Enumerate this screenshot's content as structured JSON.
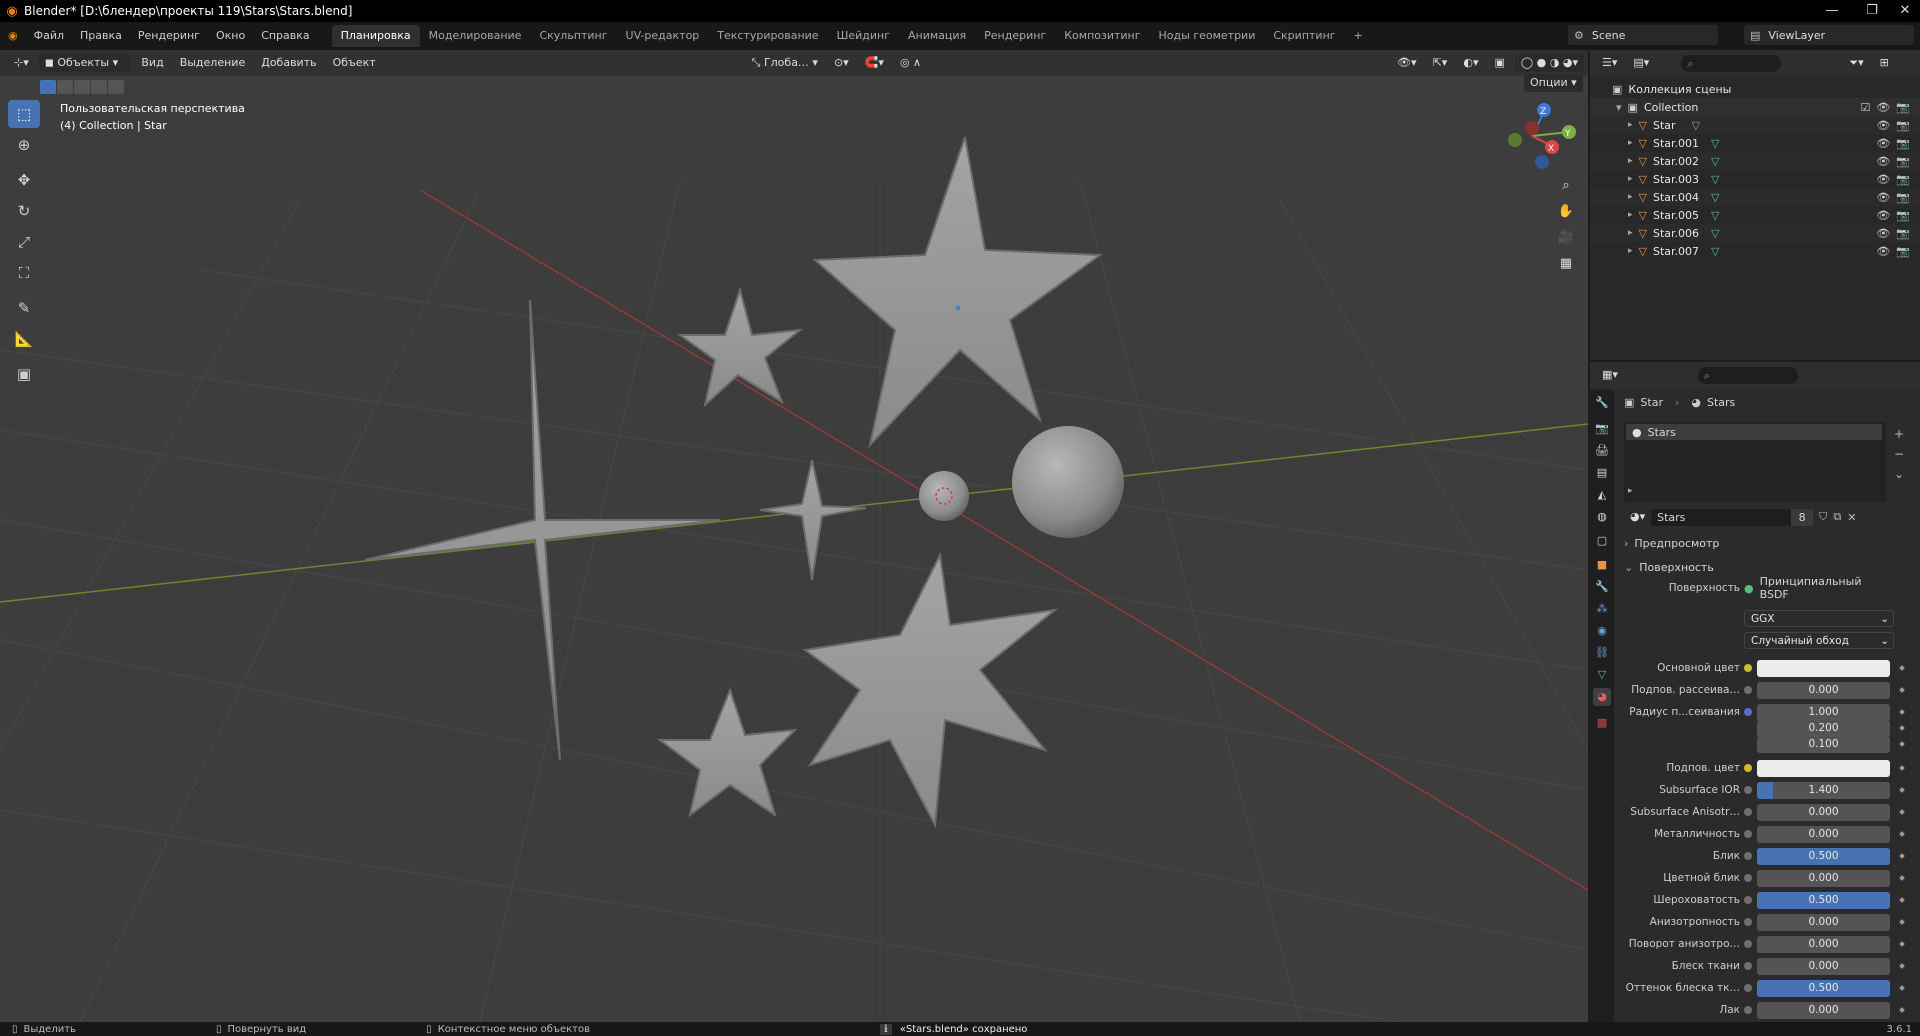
{
  "window": {
    "title": "Blender* [D:\\блендер\\проекты 119\\Stars\\Stars.blend]"
  },
  "menu": [
    "Файл",
    "Правка",
    "Рендеринг",
    "Окно",
    "Справка"
  ],
  "workspaces": {
    "active": "Планировка",
    "tabs": [
      "Моделирование",
      "Скульптинг",
      "UV-редактор",
      "Текстурирование",
      "Шейдинг",
      "Анимация",
      "Рендеринг",
      "Композитинг",
      "Ноды геометрии",
      "Скриптинг"
    ],
    "add": "+"
  },
  "scene": {
    "name": "Scene",
    "view_layer": "ViewLayer"
  },
  "viewport": {
    "mode": "Объекты",
    "menus": [
      "Вид",
      "Выделение",
      "Добавить",
      "Объект"
    ],
    "orientation": "Глоба…",
    "options": "Опции",
    "info_line1": "Пользовательская перспектива",
    "info_line2": "(4) Collection | Star",
    "gizmo": {
      "x": "X",
      "y": "Y",
      "z": "Z"
    }
  },
  "outliner": {
    "root": "Коллекция сцены",
    "collection": "Collection",
    "objects": [
      "Star",
      "Star.001",
      "Star.002",
      "Star.003",
      "Star.004",
      "Star.005",
      "Star.006",
      "Star.007"
    ]
  },
  "properties": {
    "breadcrumb_object": "Star",
    "breadcrumb_material": "Stars",
    "slot_name": "Stars",
    "material_name": "Stars",
    "users": "8",
    "panel_preview": "Предпросмотр",
    "panel_surface": "Поверхность",
    "surface_label": "Поверхность",
    "surface_shader": "Принципиальный BSDF",
    "distribution": "GGX",
    "subsurface_method": "Случайный обход",
    "fields": [
      {
        "label": "Основной цвет",
        "value": "",
        "color": "#ececec",
        "dot": "yellow",
        "fill": 0
      },
      {
        "label": "Подпов. рассеива…",
        "value": "0.000",
        "dot": "grey",
        "fill": 0
      },
      {
        "label": "Радиус п...сеивания",
        "value": "1.000",
        "dot": "blue",
        "fill": 0
      },
      {
        "label": "",
        "value": "0.200",
        "dot": "",
        "fill": 0
      },
      {
        "label": "",
        "value": "0.100",
        "dot": "",
        "fill": 0
      },
      {
        "label": "Подпов. цвет",
        "value": "",
        "color": "#ececec",
        "dot": "yellow",
        "fill": 0
      },
      {
        "label": "Subsurface IOR",
        "value": "1.400",
        "dot": "grey",
        "fill": 0.12
      },
      {
        "label": "Subsurface Anisotr…",
        "value": "0.000",
        "dot": "grey",
        "fill": 0
      },
      {
        "label": "Металличность",
        "value": "0.000",
        "dot": "grey",
        "fill": 0
      },
      {
        "label": "Блик",
        "value": "0.500",
        "dot": "grey",
        "fill": 1.0
      },
      {
        "label": "Цветной блик",
        "value": "0.000",
        "dot": "grey",
        "fill": 0
      },
      {
        "label": "Шероховатость",
        "value": "0.500",
        "dot": "grey",
        "fill": 1.0
      },
      {
        "label": "Анизотропность",
        "value": "0.000",
        "dot": "grey",
        "fill": 0
      },
      {
        "label": "Поворот анизотро…",
        "value": "0.000",
        "dot": "grey",
        "fill": 0
      },
      {
        "label": "Блеск ткани",
        "value": "0.000",
        "dot": "grey",
        "fill": 0
      },
      {
        "label": "Оттенок блеска тк…",
        "value": "0.500",
        "dot": "grey",
        "fill": 1.0
      },
      {
        "label": "Лак",
        "value": "0.000",
        "dot": "grey",
        "fill": 0
      }
    ]
  },
  "statusbar": {
    "select": "Выделить",
    "rotate": "Повернуть вид",
    "context": "Контекстное меню объектов",
    "message": "«Stars.blend» сохранено",
    "version": "3.6.1"
  }
}
